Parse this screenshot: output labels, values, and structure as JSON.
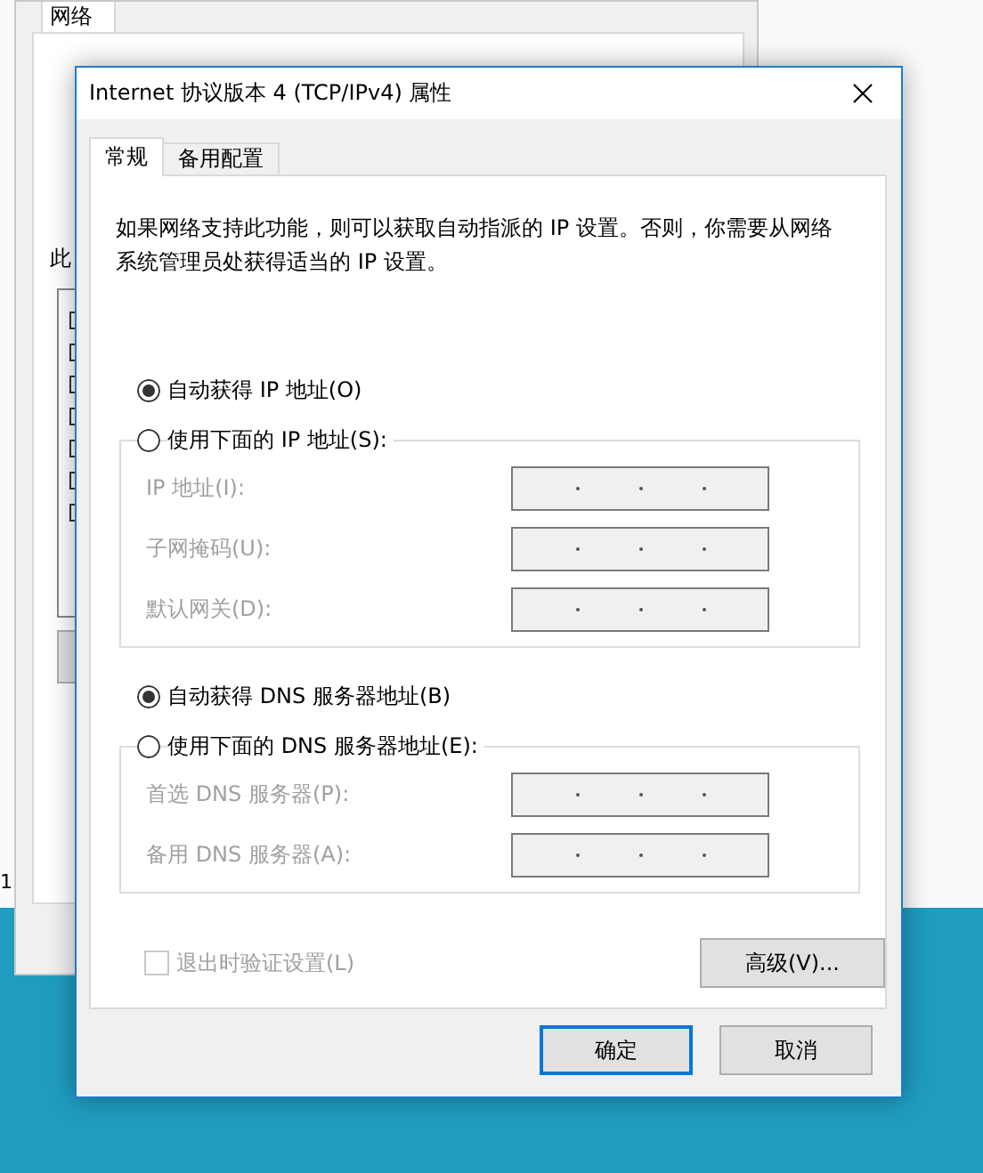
{
  "background_window": {
    "tab": "网络",
    "label": "此",
    "edge_text": "1"
  },
  "dialog": {
    "title": "Internet 协议版本 4 (TCP/IPv4) 属性",
    "tabs": [
      {
        "label": "常规",
        "selected": true
      },
      {
        "label": "备用配置",
        "selected": false
      }
    ],
    "description": "如果网络支持此功能，则可以获取自动指派的 IP 设置。否则，你需要从网络系统管理员处获得适当的 IP 设置。",
    "ip_options": [
      {
        "label": "自动获得 IP 地址(O)",
        "selected": true
      },
      {
        "label": "使用下面的 IP 地址(S):",
        "selected": false
      }
    ],
    "ip_fields": [
      {
        "label": "IP 地址(I):",
        "disabled": true
      },
      {
        "label": "子网掩码(U):",
        "disabled": true
      },
      {
        "label": "默认网关(D):",
        "disabled": true
      }
    ],
    "dns_options": [
      {
        "label": "自动获得 DNS 服务器地址(B)",
        "selected": true
      },
      {
        "label": "使用下面的 DNS 服务器地址(E):",
        "selected": false
      }
    ],
    "dns_fields": [
      {
        "label": "首选 DNS 服务器(P):",
        "disabled": true
      },
      {
        "label": "备用 DNS 服务器(A):",
        "disabled": true
      }
    ],
    "validate_checkbox": {
      "label": "退出时验证设置(L)",
      "checked": false,
      "disabled": true
    },
    "advanced_button": "高级(V)...",
    "buttons": [
      {
        "label": "确定",
        "default": true
      },
      {
        "label": "取消",
        "default": false
      }
    ]
  }
}
